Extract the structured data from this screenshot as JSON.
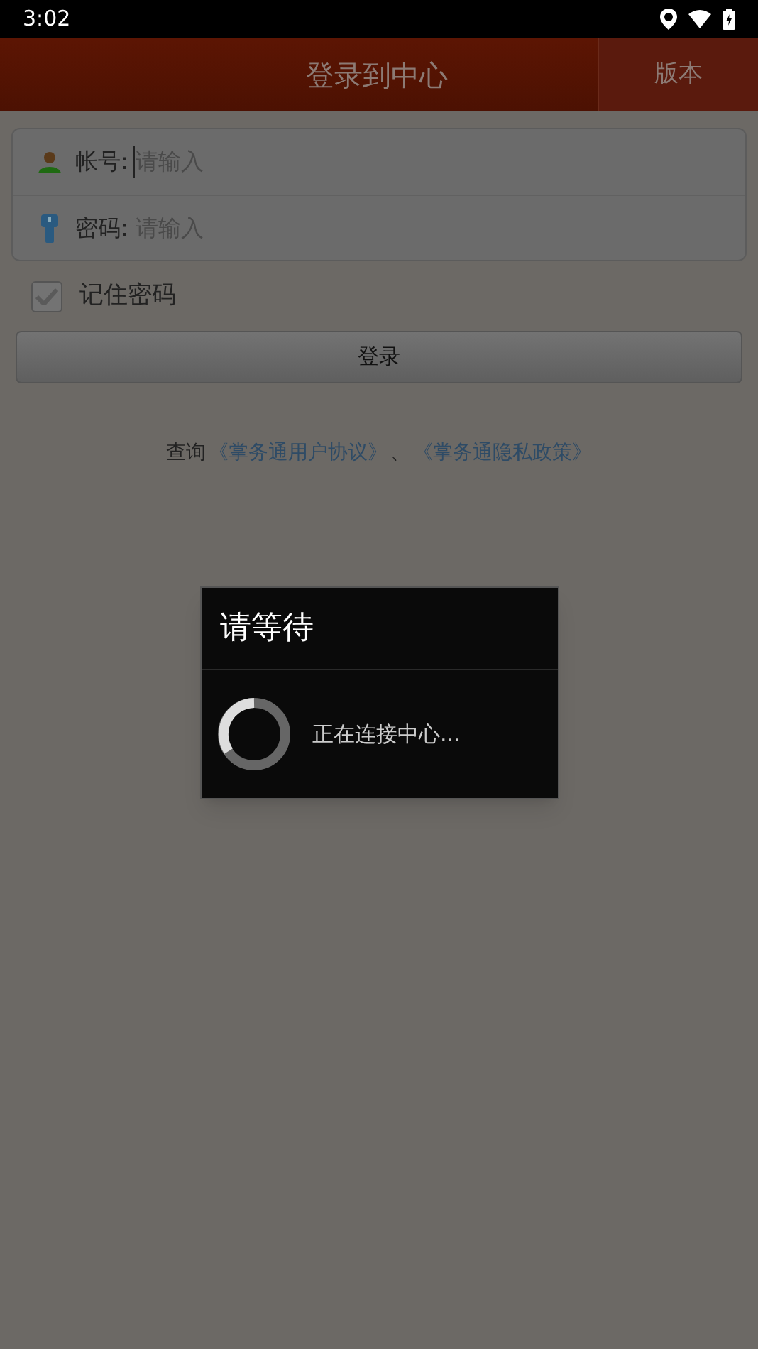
{
  "status_bar": {
    "time": "3:02"
  },
  "header": {
    "title": "登录到中心",
    "version_button": "版本"
  },
  "form": {
    "fields": [
      {
        "kind": "account",
        "label": "帐号:",
        "placeholder": "请输入",
        "focused": true
      },
      {
        "kind": "password",
        "label": "密码:",
        "placeholder": "请输入",
        "focused": false
      }
    ]
  },
  "remember": {
    "label": "记住密码",
    "checked": true
  },
  "login_button": "登录",
  "agreement": {
    "prefix": "查询",
    "links": [
      "《掌务通用户协议》",
      "《掌务通隐私政策》"
    ],
    "separator": "、"
  },
  "dialog": {
    "title": "请等待",
    "message": "正在连接中心..."
  }
}
